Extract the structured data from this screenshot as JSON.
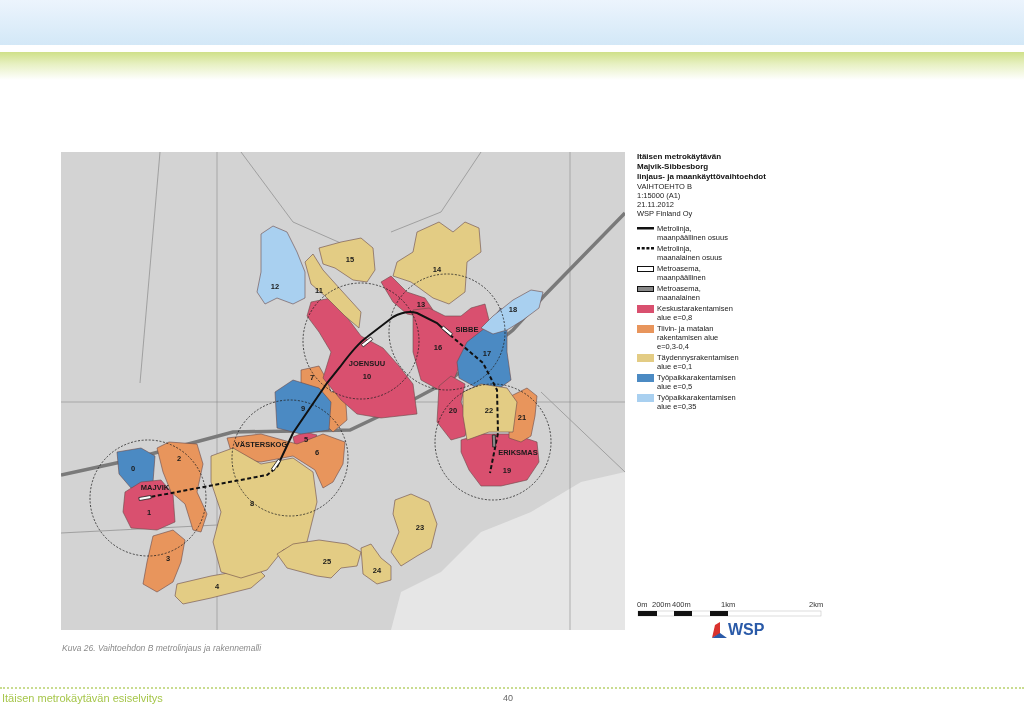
{
  "map": {
    "zones": [
      {
        "label": "0",
        "color": "#4b8ac3"
      },
      {
        "label": "1",
        "color": "#d9506f"
      },
      {
        "label": "2",
        "color": "#e8955c"
      },
      {
        "label": "3",
        "color": "#e8955c"
      },
      {
        "label": "4",
        "color": "#e3cc84"
      },
      {
        "label": "5",
        "color": "#d9506f"
      },
      {
        "label": "6",
        "color": "#e8955c"
      },
      {
        "label": "7",
        "color": "#e8955c"
      },
      {
        "label": "8",
        "color": "#e3cc84"
      },
      {
        "label": "9",
        "color": "#4b8ac3"
      },
      {
        "label": "10",
        "color": "#d9506f"
      },
      {
        "label": "11",
        "color": "#e3cc84"
      },
      {
        "label": "12",
        "color": "#a9d0f0"
      },
      {
        "label": "13",
        "color": "#d9506f"
      },
      {
        "label": "14",
        "color": "#e3cc84"
      },
      {
        "label": "15",
        "color": "#e3cc84"
      },
      {
        "label": "16",
        "color": "#d9506f"
      },
      {
        "label": "17",
        "color": "#4b8ac3"
      },
      {
        "label": "18",
        "color": "#a9d0f0"
      },
      {
        "label": "19",
        "color": "#d9506f"
      },
      {
        "label": "20",
        "color": "#d9506f"
      },
      {
        "label": "21",
        "color": "#e8955c"
      },
      {
        "label": "22",
        "color": "#e3cc84"
      },
      {
        "label": "23",
        "color": "#e3cc84"
      },
      {
        "label": "24",
        "color": "#e3cc84"
      },
      {
        "label": "25",
        "color": "#e3cc84"
      }
    ],
    "stations": [
      {
        "label": "MAJVIK",
        "kind": "surface"
      },
      {
        "label": "VÄSTERSKOG",
        "kind": "surface"
      },
      {
        "label": "JOENSUU",
        "kind": "surface"
      },
      {
        "label": "SIBBE",
        "kind": "surface"
      },
      {
        "label": "ERIKSMAS",
        "kind": "underground"
      }
    ]
  },
  "legend": {
    "title_lines": [
      "Itäisen metrokäytävän",
      "Majvik-Sibbesborg",
      "linjaus- ja maankäyttövaihtoehdot"
    ],
    "info_lines": [
      "VAIHTOEHTO B",
      "1:15000 (A1)",
      "21.11.2012",
      "WSP Finland Oy"
    ],
    "items": [
      {
        "kind": "solid-line",
        "lines": [
          "Metrolinja,",
          "maanpäällinen osuus"
        ]
      },
      {
        "kind": "dashed-line",
        "lines": [
          "Metrolinja,",
          "maanalainen osuus"
        ]
      },
      {
        "kind": "open-station",
        "lines": [
          "Metroasema,",
          "maanpäällinen"
        ]
      },
      {
        "kind": "filled-station",
        "lines": [
          "Metroasema,",
          "maanalainen"
        ]
      },
      {
        "kind": "swatch",
        "color": "#d9506f",
        "lines": [
          "Keskustarakentamisen",
          "alue e=0,8"
        ]
      },
      {
        "kind": "swatch",
        "color": "#e8955c",
        "lines": [
          "Tiivin- ja matalan",
          "rakentamisen alue",
          "e=0,3-0,4"
        ]
      },
      {
        "kind": "swatch",
        "color": "#e3cc84",
        "lines": [
          "Täydennysrakentamisen",
          "alue e=0,1"
        ]
      },
      {
        "kind": "swatch",
        "color": "#4b8ac3",
        "lines": [
          "Työpaikkarakentamisen",
          "alue e=0,5"
        ]
      },
      {
        "kind": "swatch",
        "color": "#a9d0f0",
        "lines": [
          "Työpaikkarakentamisen",
          "alue e=0,35"
        ]
      }
    ]
  },
  "scale_bar": {
    "labels": [
      "0m",
      "200m",
      "400m",
      "1km",
      "2km"
    ]
  },
  "logo": {
    "text": "WSP"
  },
  "caption": "Kuva 26. Vaihtoehdon B metrolinjaus ja rakennemalli",
  "footer": {
    "title": "Itäisen metrokäytävän esiselvitys",
    "page": "40"
  }
}
